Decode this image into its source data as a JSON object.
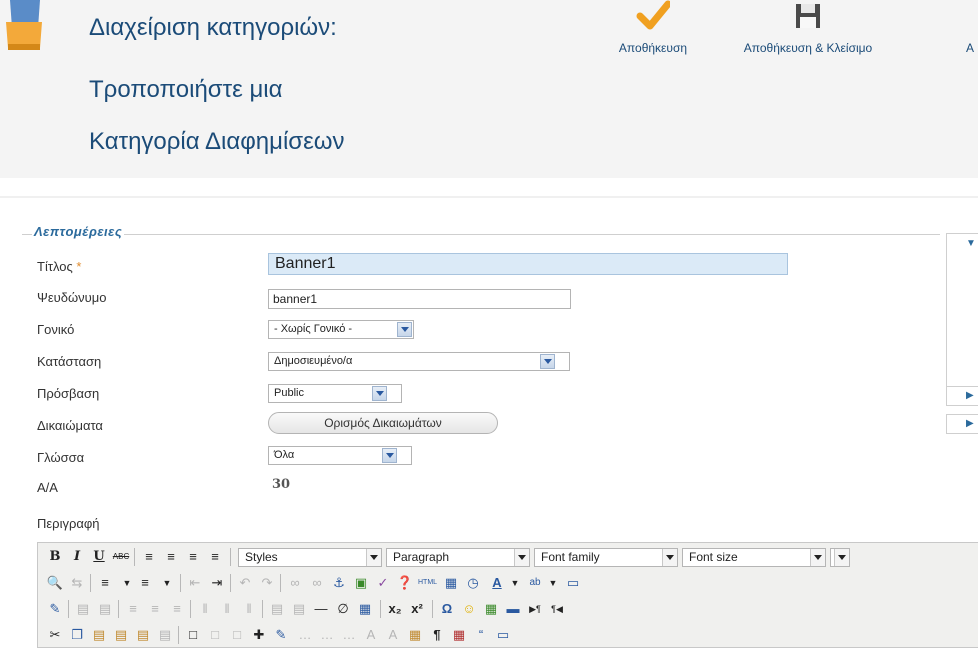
{
  "header": {
    "title_lines": [
      "Διαχείριση κατηγοριών:",
      "Τροποποιήστε μια",
      "Κατηγορία Διαφημίσεων"
    ]
  },
  "toolbar": {
    "save_label": "Αποθήκευση",
    "save_close_label": "Αποθήκευση & Κλείσιμο",
    "next_label_partial": "Α",
    "save_icon": "check-icon",
    "save_close_icon": "floppy-disk-icon"
  },
  "details": {
    "legend": "Λεπτομέρειες",
    "fields": {
      "title": {
        "label": "Τίτλος",
        "required_mark": "*",
        "value": "Banner1"
      },
      "alias": {
        "label": "Ψευδώνυμο",
        "value": "banner1"
      },
      "parent": {
        "label": "Γονικό",
        "value": "- Χωρίς Γονικό -"
      },
      "state": {
        "label": "Κατάσταση",
        "value": "Δημοσιευμένο/α"
      },
      "access": {
        "label": "Πρόσβαση",
        "value": "Public"
      },
      "permissions": {
        "label": "Δικαιώματα",
        "button": "Ορισμός Δικαιωμάτων"
      },
      "language": {
        "label": "Γλώσσα",
        "value": "Όλα"
      },
      "id": {
        "label": "Α/Α",
        "value": "30"
      }
    },
    "description_label": "Περιγραφή"
  },
  "editor": {
    "styles": "Styles",
    "paragraph": "Paragraph",
    "font_family": "Font family",
    "font_size": "Font size",
    "bold": "B",
    "italic": "I",
    "underline": "U",
    "strike": "ABC",
    "subscript": "x₂",
    "superscript": "x²",
    "omega": "Ω"
  },
  "colors": {
    "title": "#1b4b78",
    "accent_check": "#f0a020",
    "legend": "#2b6a9c",
    "title_input_bg": "#dbeaf7"
  }
}
